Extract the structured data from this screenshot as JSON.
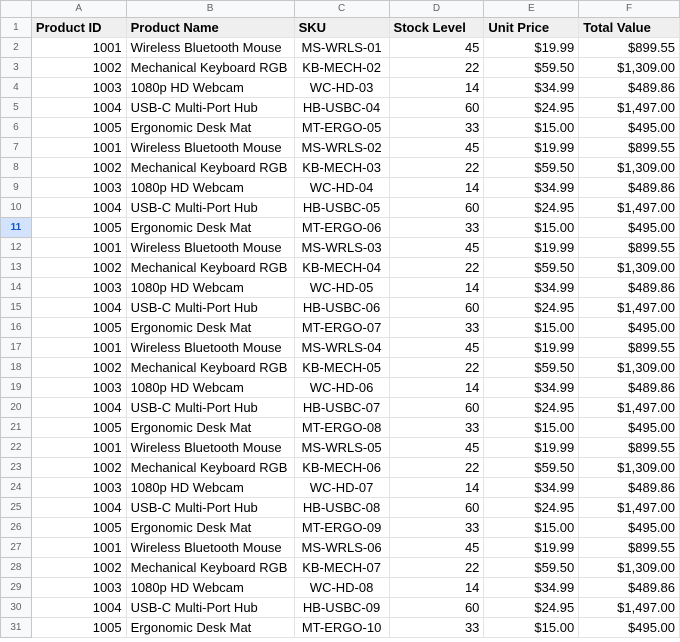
{
  "columns": [
    "A",
    "B",
    "C",
    "D",
    "E",
    "F"
  ],
  "headers": [
    "Product ID",
    "Product Name",
    "SKU",
    "Stock Level",
    "Unit Price",
    "Total Value"
  ],
  "selected_row": 11,
  "rows": [
    [
      "1001",
      "Wireless Bluetooth Mouse",
      "MS-WRLS-01",
      "45",
      "$19.99",
      "$899.55"
    ],
    [
      "1002",
      "Mechanical Keyboard RGB",
      "KB-MECH-02",
      "22",
      "$59.50",
      "$1,309.00"
    ],
    [
      "1003",
      "1080p HD Webcam",
      "WC-HD-03",
      "14",
      "$34.99",
      "$489.86"
    ],
    [
      "1004",
      "USB-C Multi-Port Hub",
      "HB-USBC-04",
      "60",
      "$24.95",
      "$1,497.00"
    ],
    [
      "1005",
      "Ergonomic Desk Mat",
      "MT-ERGO-05",
      "33",
      "$15.00",
      "$495.00"
    ],
    [
      "1001",
      "Wireless Bluetooth Mouse",
      "MS-WRLS-02",
      "45",
      "$19.99",
      "$899.55"
    ],
    [
      "1002",
      "Mechanical Keyboard RGB",
      "KB-MECH-03",
      "22",
      "$59.50",
      "$1,309.00"
    ],
    [
      "1003",
      "1080p HD Webcam",
      "WC-HD-04",
      "14",
      "$34.99",
      "$489.86"
    ],
    [
      "1004",
      "USB-C Multi-Port Hub",
      "HB-USBC-05",
      "60",
      "$24.95",
      "$1,497.00"
    ],
    [
      "1005",
      "Ergonomic Desk Mat",
      "MT-ERGO-06",
      "33",
      "$15.00",
      "$495.00"
    ],
    [
      "1001",
      "Wireless Bluetooth Mouse",
      "MS-WRLS-03",
      "45",
      "$19.99",
      "$899.55"
    ],
    [
      "1002",
      "Mechanical Keyboard RGB",
      "KB-MECH-04",
      "22",
      "$59.50",
      "$1,309.00"
    ],
    [
      "1003",
      "1080p HD Webcam",
      "WC-HD-05",
      "14",
      "$34.99",
      "$489.86"
    ],
    [
      "1004",
      "USB-C Multi-Port Hub",
      "HB-USBC-06",
      "60",
      "$24.95",
      "$1,497.00"
    ],
    [
      "1005",
      "Ergonomic Desk Mat",
      "MT-ERGO-07",
      "33",
      "$15.00",
      "$495.00"
    ],
    [
      "1001",
      "Wireless Bluetooth Mouse",
      "MS-WRLS-04",
      "45",
      "$19.99",
      "$899.55"
    ],
    [
      "1002",
      "Mechanical Keyboard RGB",
      "KB-MECH-05",
      "22",
      "$59.50",
      "$1,309.00"
    ],
    [
      "1003",
      "1080p HD Webcam",
      "WC-HD-06",
      "14",
      "$34.99",
      "$489.86"
    ],
    [
      "1004",
      "USB-C Multi-Port Hub",
      "HB-USBC-07",
      "60",
      "$24.95",
      "$1,497.00"
    ],
    [
      "1005",
      "Ergonomic Desk Mat",
      "MT-ERGO-08",
      "33",
      "$15.00",
      "$495.00"
    ],
    [
      "1001",
      "Wireless Bluetooth Mouse",
      "MS-WRLS-05",
      "45",
      "$19.99",
      "$899.55"
    ],
    [
      "1002",
      "Mechanical Keyboard RGB",
      "KB-MECH-06",
      "22",
      "$59.50",
      "$1,309.00"
    ],
    [
      "1003",
      "1080p HD Webcam",
      "WC-HD-07",
      "14",
      "$34.99",
      "$489.86"
    ],
    [
      "1004",
      "USB-C Multi-Port Hub",
      "HB-USBC-08",
      "60",
      "$24.95",
      "$1,497.00"
    ],
    [
      "1005",
      "Ergonomic Desk Mat",
      "MT-ERGO-09",
      "33",
      "$15.00",
      "$495.00"
    ],
    [
      "1001",
      "Wireless Bluetooth Mouse",
      "MS-WRLS-06",
      "45",
      "$19.99",
      "$899.55"
    ],
    [
      "1002",
      "Mechanical Keyboard RGB",
      "KB-MECH-07",
      "22",
      "$59.50",
      "$1,309.00"
    ],
    [
      "1003",
      "1080p HD Webcam",
      "WC-HD-08",
      "14",
      "$34.99",
      "$489.86"
    ],
    [
      "1004",
      "USB-C Multi-Port Hub",
      "HB-USBC-09",
      "60",
      "$24.95",
      "$1,497.00"
    ],
    [
      "1005",
      "Ergonomic Desk Mat",
      "MT-ERGO-10",
      "33",
      "$15.00",
      "$495.00"
    ]
  ],
  "colors": {
    "header_fill": "#efefef",
    "gridline": "#e2e3e3",
    "selected_row_header": "#d3e3fd",
    "selected_row_text": "#0b57d0"
  }
}
